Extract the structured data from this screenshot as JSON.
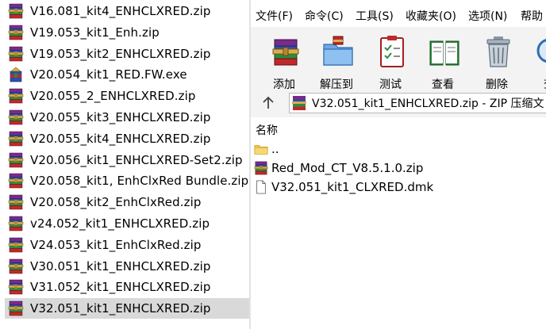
{
  "left_panel": {
    "files": [
      {
        "name": "V16.081_kit4_ENHCLXRED.zip",
        "icon": "winrar-archive-icon"
      },
      {
        "name": "V19.053_kit1_Enh.zip",
        "icon": "winrar-archive-icon"
      },
      {
        "name": "V19.053_kit2_ENHCLXRED.zip",
        "icon": "winrar-archive-icon"
      },
      {
        "name": "V20.054_kit1_RED.FW.exe",
        "icon": "sfx-installer-icon"
      },
      {
        "name": "V20.055_2_ENHCLXRED.zip",
        "icon": "winrar-archive-icon"
      },
      {
        "name": "V20.055_kit3_ENHCLXRED.zip",
        "icon": "winrar-archive-icon"
      },
      {
        "name": "V20.055_kit4_ENHCLXRED.zip",
        "icon": "winrar-archive-icon"
      },
      {
        "name": "V20.056_kit1_ENHCLXRED-Set2.zip",
        "icon": "winrar-archive-icon"
      },
      {
        "name": "V20.058_kit1, EnhClxRed Bundle.zip",
        "icon": "winrar-archive-icon"
      },
      {
        "name": "V20.058_kit2_EnhClxRed.zip",
        "icon": "winrar-archive-icon"
      },
      {
        "name": "v24.052_kit1_ENHCLXRED.zip",
        "icon": "winrar-archive-icon"
      },
      {
        "name": "V24.053_kit1_EnhClxRed.zip",
        "icon": "winrar-archive-icon"
      },
      {
        "name": "V30.051_kit1_ENHCLXRED.zip",
        "icon": "winrar-archive-icon"
      },
      {
        "name": "V31.052_kit1_ENHCLXRED.zip",
        "icon": "winrar-archive-icon"
      },
      {
        "name": "V32.051_kit1_ENHCLXRED.zip",
        "icon": "winrar-archive-icon",
        "selected": true
      }
    ]
  },
  "winrar": {
    "menu": [
      "文件(F)",
      "命令(C)",
      "工具(S)",
      "收藏夹(O)",
      "选项(N)",
      "帮助"
    ],
    "toolbar": [
      {
        "label": "添加",
        "icon": "add-icon"
      },
      {
        "label": "解压到",
        "icon": "extract-to-icon"
      },
      {
        "label": "测试",
        "icon": "test-icon"
      },
      {
        "label": "查看",
        "icon": "view-icon"
      },
      {
        "label": "删除",
        "icon": "delete-icon"
      },
      {
        "label": "查",
        "icon": "find-icon"
      }
    ],
    "path": "V32.051_kit1_ENHCLXRED.zip - ZIP 压缩文",
    "column_name": "名称",
    "entries": [
      {
        "name": "..",
        "icon": "folder-up-icon"
      },
      {
        "name": "Red_Mod_CT_V8.5.1.0.zip",
        "icon": "winrar-archive-icon"
      },
      {
        "name": "V32.051_kit1_CLXRED.dmk",
        "icon": "file-icon"
      }
    ]
  },
  "colors": {
    "selection": "#d9d9d9",
    "toolbar_bg": "#f3f3f3",
    "rar_red": "#c0282c",
    "rar_blue": "#2a4fa8",
    "rar_green": "#2e8b3d",
    "rar_purple": "#7a2a8a"
  }
}
